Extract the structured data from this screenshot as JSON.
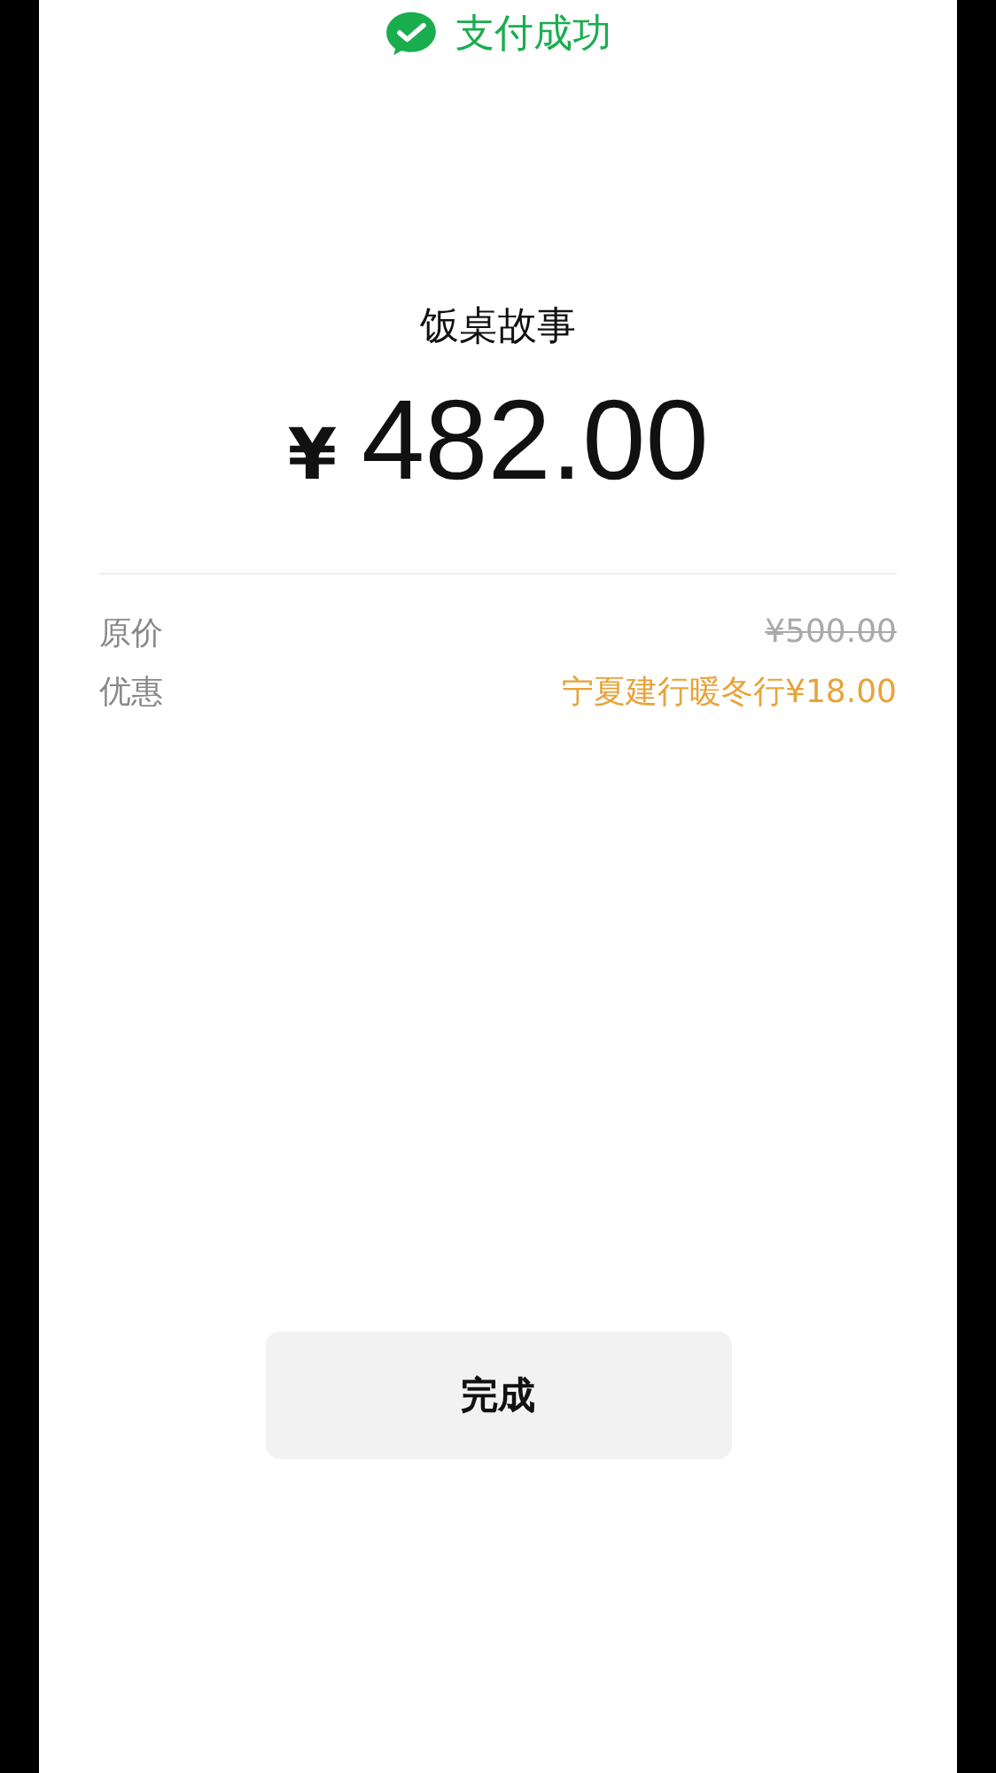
{
  "header": {
    "title": "支付成功"
  },
  "merchant": "饭桌故事",
  "amount": {
    "currency": "¥",
    "value": "482.00"
  },
  "details": [
    {
      "label": "原价",
      "value": "¥500.00",
      "kind": "original"
    },
    {
      "label": "优惠",
      "value": "宁夏建行暖冬行¥18.00",
      "kind": "discount"
    }
  ],
  "buttons": [
    "完成"
  ]
}
